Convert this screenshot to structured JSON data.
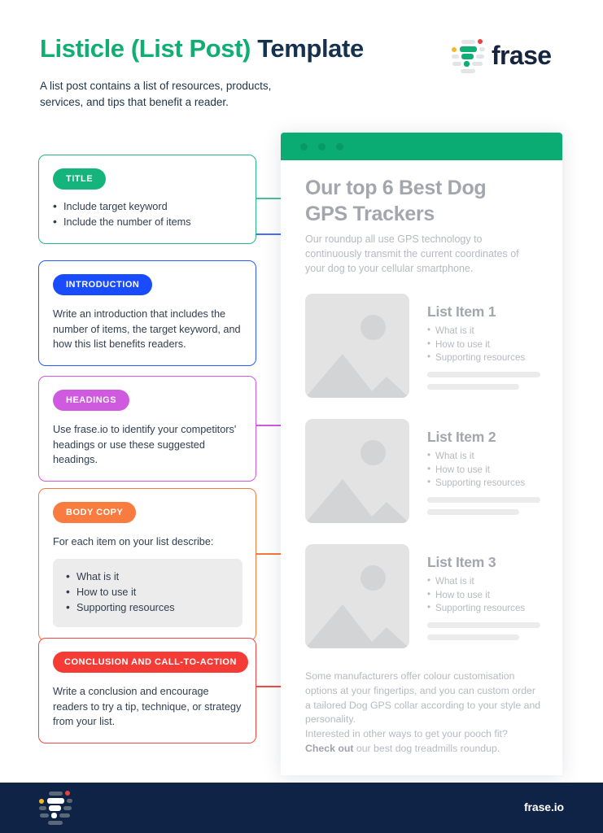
{
  "header": {
    "title_accent": "Listicle (List Post)",
    "title_rest": " Template",
    "subtitle": "A list post contains a list of resources, products, services, and tips that benefit a reader.",
    "brand": "frase"
  },
  "colors": {
    "green": "#0fae72",
    "blue": "#1a4cff",
    "magenta": "#d44ae0",
    "orange": "#f87b3f",
    "red": "#f53b36",
    "navy": "#0e2346",
    "mock_green": "#0bab74"
  },
  "cards": [
    {
      "badge": "TITLE",
      "color": "#0fae72",
      "body": "",
      "bullets": [
        "Include target keyword",
        "Include the number of items"
      ],
      "inner_bullets": []
    },
    {
      "badge": "INTRODUCTION",
      "color": "#1a4cff",
      "body": "Write an introduction that includes the number of items, the target keyword, and how this list benefits readers.",
      "bullets": [],
      "inner_bullets": []
    },
    {
      "badge": "HEADINGS",
      "color": "#d44ae0",
      "body": "Use frase.io to identify your competitors' headings or use these suggested headings.",
      "bullets": [],
      "inner_bullets": []
    },
    {
      "badge": "BODY COPY",
      "color": "#f87b3f",
      "body": "For each item on your list describe:",
      "bullets": [],
      "inner_bullets": [
        "What is it",
        "How to use it",
        "Supporting resources"
      ]
    },
    {
      "badge": "CONCLUSION AND CALL-TO-ACTION",
      "color": "#f53b36",
      "body": "Write a conclusion and encourage readers to try a tip, technique, or strategy from your list.",
      "bullets": [],
      "inner_bullets": []
    }
  ],
  "mockup": {
    "title": "Our top 6 Best Dog GPS Trackers",
    "intro": "Our roundup all use GPS technology to continuously transmit the current coordinates of your dog to your cellular smartphone.",
    "items": [
      {
        "title": "List Item 1",
        "bullets": [
          "What is it",
          "How to use it",
          "Supporting resources"
        ]
      },
      {
        "title": "List Item 2",
        "bullets": [
          "What is it",
          "How to use it",
          "Supporting resources"
        ]
      },
      {
        "title": "List Item 3",
        "bullets": [
          "What is it",
          "How to use it",
          "Supporting resources"
        ]
      }
    ],
    "outro_p1": "Some manufacturers offer colour customisation options at your fingertips, and you can custom order a tailored Dog GPS collar according to your style and personality.",
    "outro_p2": "Interested in other ways to get your pooch fit?",
    "outro_bold": "Check out",
    "outro_p3": " our best dog treadmills roundup."
  },
  "footer": {
    "url": "frase.io"
  }
}
